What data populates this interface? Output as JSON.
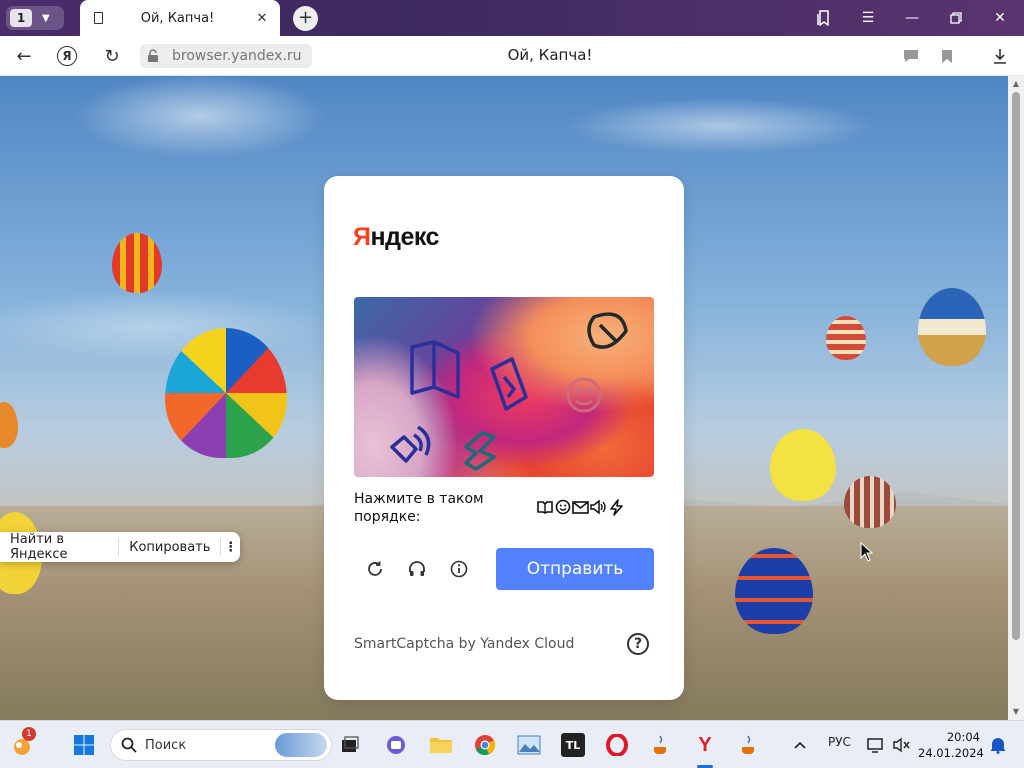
{
  "browser": {
    "tab_count": "1",
    "tab_title": "Ой, Капча!",
    "url": "browser.yandex.ru",
    "page_title": "Ой, Капча!"
  },
  "context_menu": {
    "find": "Найти в Яндексе",
    "copy": "Копировать"
  },
  "captcha": {
    "logo_first": "Я",
    "logo_rest": "ндекс",
    "instruction": "Нажмите в таком порядке:",
    "sequence_icons": [
      "book-icon",
      "smile-icon",
      "envelope-icon",
      "speaker-icon",
      "lightning-icon"
    ],
    "submit_label": "Отправить",
    "footer": "SmartCaptcha by Yandex Cloud",
    "help": "?",
    "accent": "#5282ff",
    "logo_accent": "#fc3f1d"
  },
  "taskbar": {
    "widget_badge": "1",
    "search_placeholder": "Поиск",
    "language": "РУС",
    "time": "20:04",
    "date": "24.01.2024"
  }
}
